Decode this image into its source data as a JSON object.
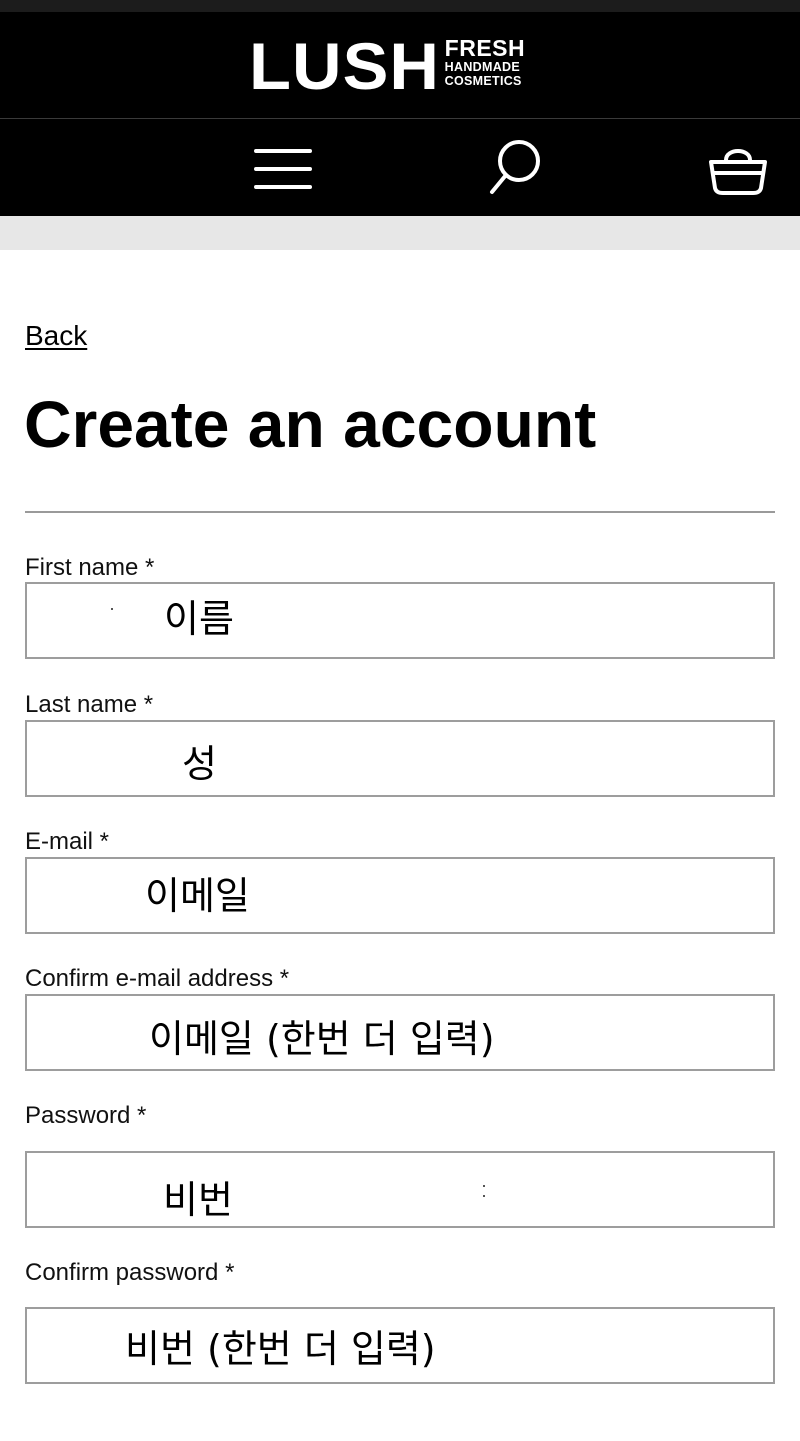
{
  "header": {
    "logo_main": "LUSH",
    "logo_fresh": "FRESH",
    "logo_handmade": "HANDMADE",
    "logo_cosmetics": "COSMETICS",
    "icons": [
      "menu-icon",
      "search-icon",
      "bag-icon"
    ]
  },
  "nav": {
    "back_label": "Back"
  },
  "page": {
    "title": "Create an account"
  },
  "form": {
    "fields": [
      {
        "label": "First name *",
        "value": "이름"
      },
      {
        "label": "Last name *",
        "value": "성"
      },
      {
        "label": "E-mail *",
        "value": "이메일"
      },
      {
        "label": "Confirm e-mail address *",
        "value": "이메일 (한번 더 입력)"
      },
      {
        "label": "Password *",
        "value": "비번"
      },
      {
        "label": "Confirm password *",
        "value": "비번 (한번 더 입력)"
      }
    ]
  },
  "colors": {
    "header_bg": "#000000",
    "band_bg": "#e7e7e7",
    "input_border": "#9d9d9d"
  }
}
